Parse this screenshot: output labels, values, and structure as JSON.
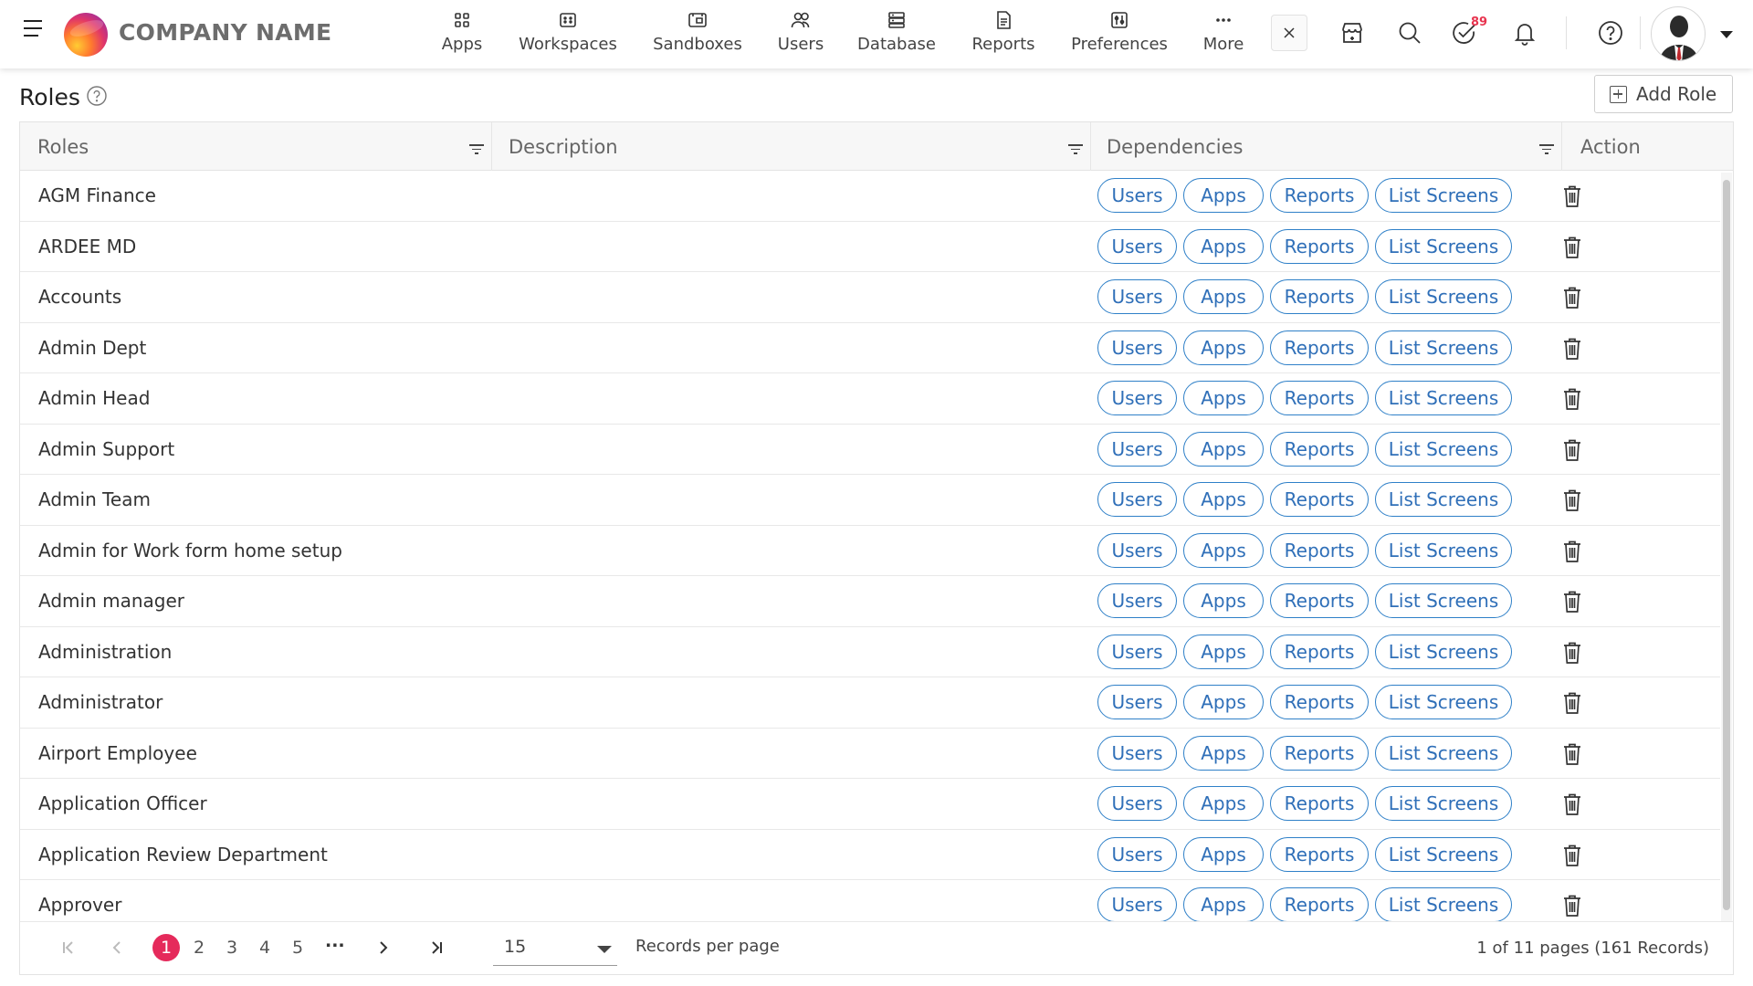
{
  "brand": {
    "company_name": "COMPANY NAME"
  },
  "nav": [
    {
      "label": "Apps",
      "icon": "apps-grid-icon"
    },
    {
      "label": "Workspaces",
      "icon": "workspace-icon"
    },
    {
      "label": "Sandboxes",
      "icon": "sandbox-icon"
    },
    {
      "label": "Users",
      "icon": "users-icon"
    },
    {
      "label": "Database",
      "icon": "database-icon"
    },
    {
      "label": "Reports",
      "icon": "report-document-icon"
    },
    {
      "label": "Preferences",
      "icon": "preferences-icon"
    },
    {
      "label": "More",
      "icon": "more-dots-icon"
    }
  ],
  "toolbar": {
    "tasks_badge": "89",
    "icons": [
      "close-icon",
      "store-icon",
      "search-icon",
      "tasks-check-icon",
      "bell-icon",
      "help-icon",
      "avatar",
      "chevron-down-icon"
    ]
  },
  "page": {
    "title": "Roles",
    "add_button_label": "Add Role"
  },
  "table": {
    "columns": [
      "Roles",
      "Description",
      "Dependencies",
      "Action"
    ],
    "dependency_buttons": [
      "Users",
      "Apps",
      "Reports",
      "List Screens"
    ],
    "rows": [
      {
        "role": "AGM Finance",
        "description": ""
      },
      {
        "role": "ARDEE MD",
        "description": ""
      },
      {
        "role": "Accounts",
        "description": ""
      },
      {
        "role": "Admin Dept",
        "description": ""
      },
      {
        "role": "Admin Head",
        "description": ""
      },
      {
        "role": "Admin Support",
        "description": ""
      },
      {
        "role": "Admin Team",
        "description": ""
      },
      {
        "role": "Admin for Work form home setup",
        "description": ""
      },
      {
        "role": "Admin manager",
        "description": ""
      },
      {
        "role": "Administration",
        "description": ""
      },
      {
        "role": "Administrator",
        "description": ""
      },
      {
        "role": "Airport Employee",
        "description": ""
      },
      {
        "role": "Application Officer",
        "description": ""
      },
      {
        "role": "Application Review Department",
        "description": ""
      },
      {
        "role": "Approver",
        "description": ""
      }
    ]
  },
  "pagination": {
    "pages": [
      "1",
      "2",
      "3",
      "4",
      "5"
    ],
    "active_page": "1",
    "ellipsis": "...",
    "per_page_value": "15",
    "per_page_label": "Records per page",
    "info": "1 of 11 pages (161 Records)"
  },
  "colors": {
    "accent_pink": "#e52a5b",
    "pill_blue": "#2f80c8",
    "badge_red": "#e8344f"
  }
}
